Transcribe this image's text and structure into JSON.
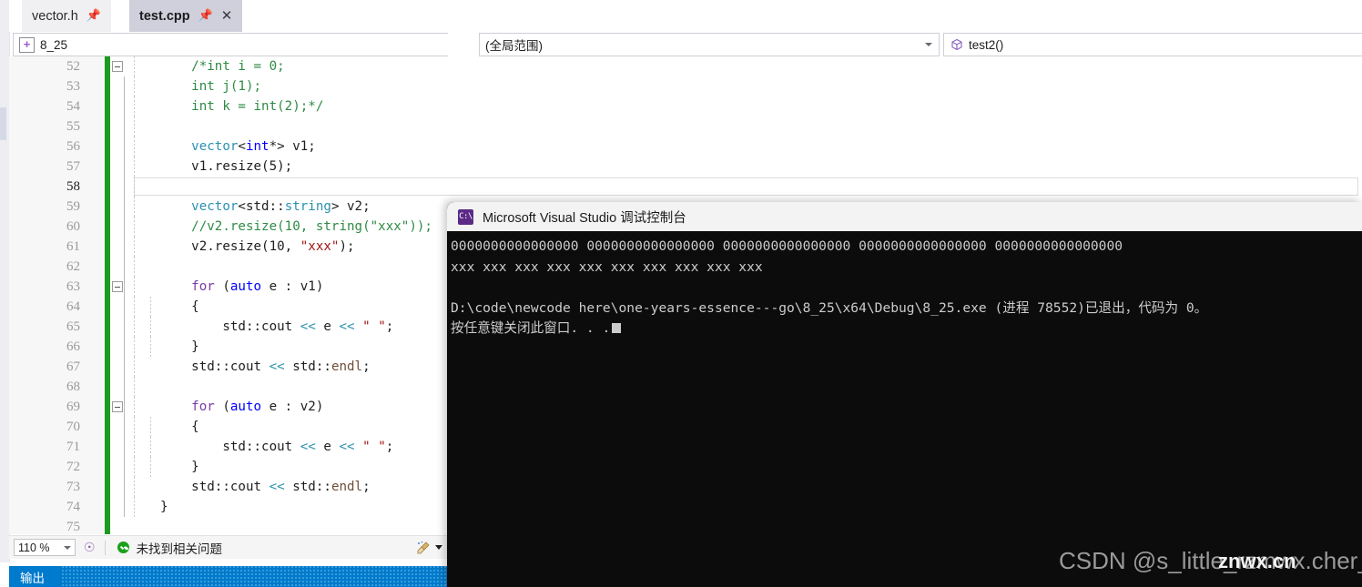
{
  "editor_window": {
    "tabs": [
      {
        "label": "vector.h",
        "active": false,
        "pin_icon": "pin-icon",
        "has_close": false
      },
      {
        "label": "test.cpp",
        "active": true,
        "pin_icon": "pin-icon",
        "has_close": true
      }
    ],
    "navbar": {
      "project": "8_25",
      "project_icon": "cpp-project-icon",
      "scope": "(全局范围)",
      "member": "test2()",
      "member_icon": "method-cube-icon"
    },
    "gutter_change_color": "#1d9b1d",
    "current_line": 58,
    "lines": [
      {
        "n": 52,
        "fold": "collapse",
        "code": [
          {
            "t": "    ",
            "c": "id"
          },
          {
            "t": "/*int i = 0;",
            "c": "cm"
          }
        ]
      },
      {
        "n": 53,
        "fold": "",
        "code": [
          {
            "t": "    ",
            "c": "id"
          },
          {
            "t": "int j(1);",
            "c": "cm"
          }
        ]
      },
      {
        "n": 54,
        "fold": "",
        "code": [
          {
            "t": "    ",
            "c": "id"
          },
          {
            "t": "int k = int(2);*/",
            "c": "cm"
          }
        ]
      },
      {
        "n": 55,
        "fold": "",
        "code": []
      },
      {
        "n": 56,
        "fold": "",
        "code": [
          {
            "t": "    ",
            "c": "id"
          },
          {
            "t": "vector",
            "c": "t"
          },
          {
            "t": "<",
            "c": "op"
          },
          {
            "t": "int",
            "c": "k"
          },
          {
            "t": "*> ",
            "c": "op"
          },
          {
            "t": "v1;",
            "c": "id"
          }
        ]
      },
      {
        "n": 57,
        "fold": "",
        "code": [
          {
            "t": "    v1.",
            "c": "id"
          },
          {
            "t": "resize",
            "c": "id"
          },
          {
            "t": "(5);",
            "c": "id"
          }
        ]
      },
      {
        "n": 58,
        "fold": "",
        "code": []
      },
      {
        "n": 59,
        "fold": "",
        "code": [
          {
            "t": "    ",
            "c": "id"
          },
          {
            "t": "vector",
            "c": "t"
          },
          {
            "t": "<",
            "c": "op"
          },
          {
            "t": "std",
            "c": "id"
          },
          {
            "t": "::",
            "c": "op"
          },
          {
            "t": "string",
            "c": "t"
          },
          {
            "t": "> v2;",
            "c": "id"
          }
        ]
      },
      {
        "n": 60,
        "fold": "",
        "code": [
          {
            "t": "    ",
            "c": "id"
          },
          {
            "t": "//v2.resize(10, string(\"xxx\"));",
            "c": "cm"
          }
        ]
      },
      {
        "n": 61,
        "fold": "",
        "code": [
          {
            "t": "    v2.resize(10, ",
            "c": "id"
          },
          {
            "t": "\"xxx\"",
            "c": "str"
          },
          {
            "t": ");",
            "c": "id"
          }
        ]
      },
      {
        "n": 62,
        "fold": "",
        "code": []
      },
      {
        "n": 63,
        "fold": "collapse",
        "code": [
          {
            "t": "    ",
            "c": "id"
          },
          {
            "t": "for",
            "c": "kv"
          },
          {
            "t": " (",
            "c": "id"
          },
          {
            "t": "auto",
            "c": "k"
          },
          {
            "t": " e : v1)",
            "c": "id"
          }
        ]
      },
      {
        "n": 64,
        "fold": "",
        "code": [
          {
            "t": "    {",
            "c": "id"
          }
        ]
      },
      {
        "n": 65,
        "fold": "",
        "code": [
          {
            "t": "        std::",
            "c": "id"
          },
          {
            "t": "cout",
            "c": "id"
          },
          {
            "t": " ",
            "c": "id"
          },
          {
            "t": "<<",
            "c": "t"
          },
          {
            "t": " e ",
            "c": "id"
          },
          {
            "t": "<<",
            "c": "t"
          },
          {
            "t": " ",
            "c": "id"
          },
          {
            "t": "\" \"",
            "c": "str"
          },
          {
            "t": ";",
            "c": "id"
          }
        ]
      },
      {
        "n": 66,
        "fold": "",
        "code": [
          {
            "t": "    }",
            "c": "id"
          }
        ]
      },
      {
        "n": 67,
        "fold": "",
        "code": [
          {
            "t": "    std::",
            "c": "id"
          },
          {
            "t": "cout",
            "c": "id"
          },
          {
            "t": " ",
            "c": "id"
          },
          {
            "t": "<<",
            "c": "t"
          },
          {
            "t": " std::",
            "c": "id"
          },
          {
            "t": "endl",
            "c": "mem"
          },
          {
            "t": ";",
            "c": "id"
          }
        ]
      },
      {
        "n": 68,
        "fold": "",
        "code": []
      },
      {
        "n": 69,
        "fold": "collapse",
        "code": [
          {
            "t": "    ",
            "c": "id"
          },
          {
            "t": "for",
            "c": "kv"
          },
          {
            "t": " (",
            "c": "id"
          },
          {
            "t": "auto",
            "c": "k"
          },
          {
            "t": " e : v2)",
            "c": "id"
          }
        ]
      },
      {
        "n": 70,
        "fold": "",
        "code": [
          {
            "t": "    {",
            "c": "id"
          }
        ]
      },
      {
        "n": 71,
        "fold": "",
        "code": [
          {
            "t": "        std::",
            "c": "id"
          },
          {
            "t": "cout",
            "c": "id"
          },
          {
            "t": " ",
            "c": "id"
          },
          {
            "t": "<<",
            "c": "t"
          },
          {
            "t": " e ",
            "c": "id"
          },
          {
            "t": "<<",
            "c": "t"
          },
          {
            "t": " ",
            "c": "id"
          },
          {
            "t": "\" \"",
            "c": "str"
          },
          {
            "t": ";",
            "c": "id"
          }
        ]
      },
      {
        "n": 72,
        "fold": "",
        "code": [
          {
            "t": "    }",
            "c": "id"
          }
        ]
      },
      {
        "n": 73,
        "fold": "",
        "code": [
          {
            "t": "    std::",
            "c": "id"
          },
          {
            "t": "cout",
            "c": "id"
          },
          {
            "t": " ",
            "c": "id"
          },
          {
            "t": "<<",
            "c": "t"
          },
          {
            "t": " std::",
            "c": "id"
          },
          {
            "t": "endl",
            "c": "mem"
          },
          {
            "t": ";",
            "c": "id"
          }
        ]
      },
      {
        "n": 74,
        "fold": "",
        "code": [
          {
            "t": "}",
            "c": "id"
          }
        ]
      },
      {
        "n": 75,
        "fold": "",
        "code": []
      }
    ],
    "statusbar": {
      "zoom": "110 %",
      "intellisense_icon": "intellisense-brain-icon",
      "status_icon": "ok-check-icon",
      "status_text": "未找到相关问题",
      "broom_icon": "code-cleanup-broom-icon",
      "broom_caret_icon": "chevron-down-icon"
    },
    "output_pane": {
      "title": "输出"
    }
  },
  "console_window": {
    "icon": "cmd-icon",
    "title": "Microsoft Visual Studio 调试控制台",
    "lines": [
      "0000000000000000 0000000000000000 0000000000000000 0000000000000000 0000000000000000",
      "xxx xxx xxx xxx xxx xxx xxx xxx xxx xxx",
      "",
      "D:\\code\\newcode here\\one-years-essence---go\\8_25\\x64\\Debug\\8_25.exe (进程 78552)已退出，代码为 0。",
      "按任意键关闭此窗口. . ."
    ]
  },
  "watermarks": {
    "primary": "CSDN @s_little_rzmwx.cher_",
    "secondary": "znwx.cn"
  }
}
